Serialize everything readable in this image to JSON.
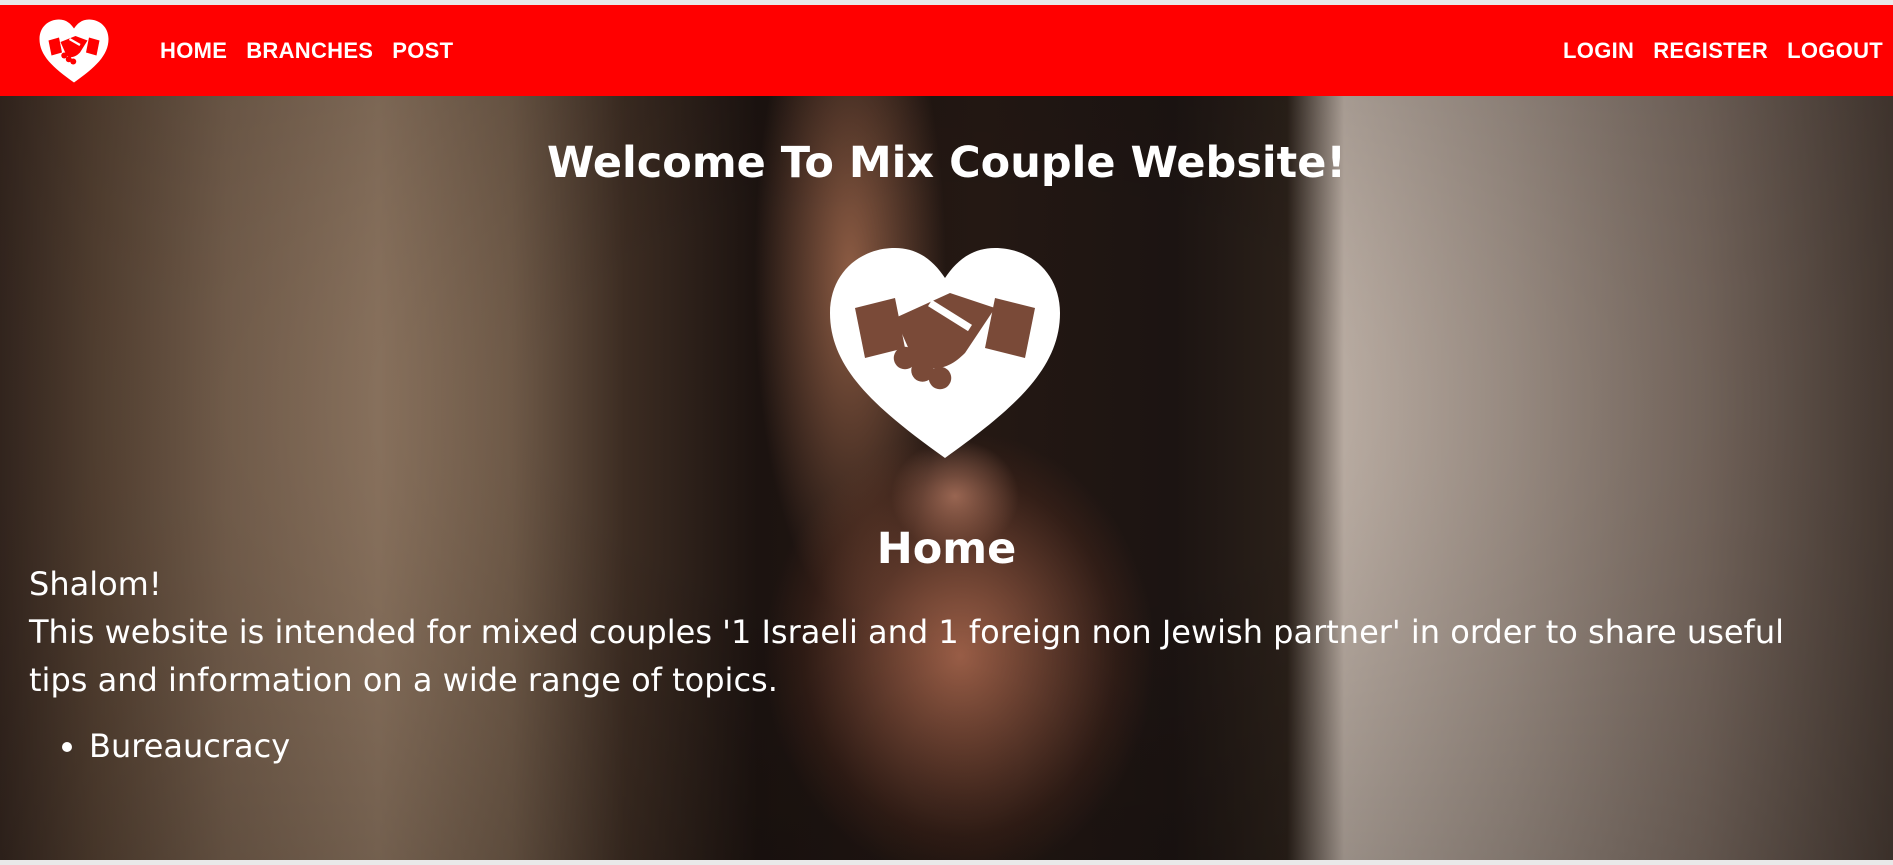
{
  "nav": {
    "left_links": [
      "HOME",
      "BRANCHES",
      "POST"
    ],
    "right_links": [
      "LOGIN",
      "REGISTER",
      "LOGOUT"
    ]
  },
  "hero": {
    "title": "Welcome To Mix Couple Website!",
    "section_title": "Home",
    "greeting": "Shalom!",
    "intro": "This website is intended for mixed couples '1 Israeli and 1 foreign non Jewish partner' in order to share useful tips and information on a wide range of topics.",
    "topics": [
      "Bureaucracy"
    ]
  },
  "icons": {
    "logo": "heart-handshake-icon"
  },
  "colors": {
    "navbar": "#ff0000",
    "text": "#ffffff"
  }
}
